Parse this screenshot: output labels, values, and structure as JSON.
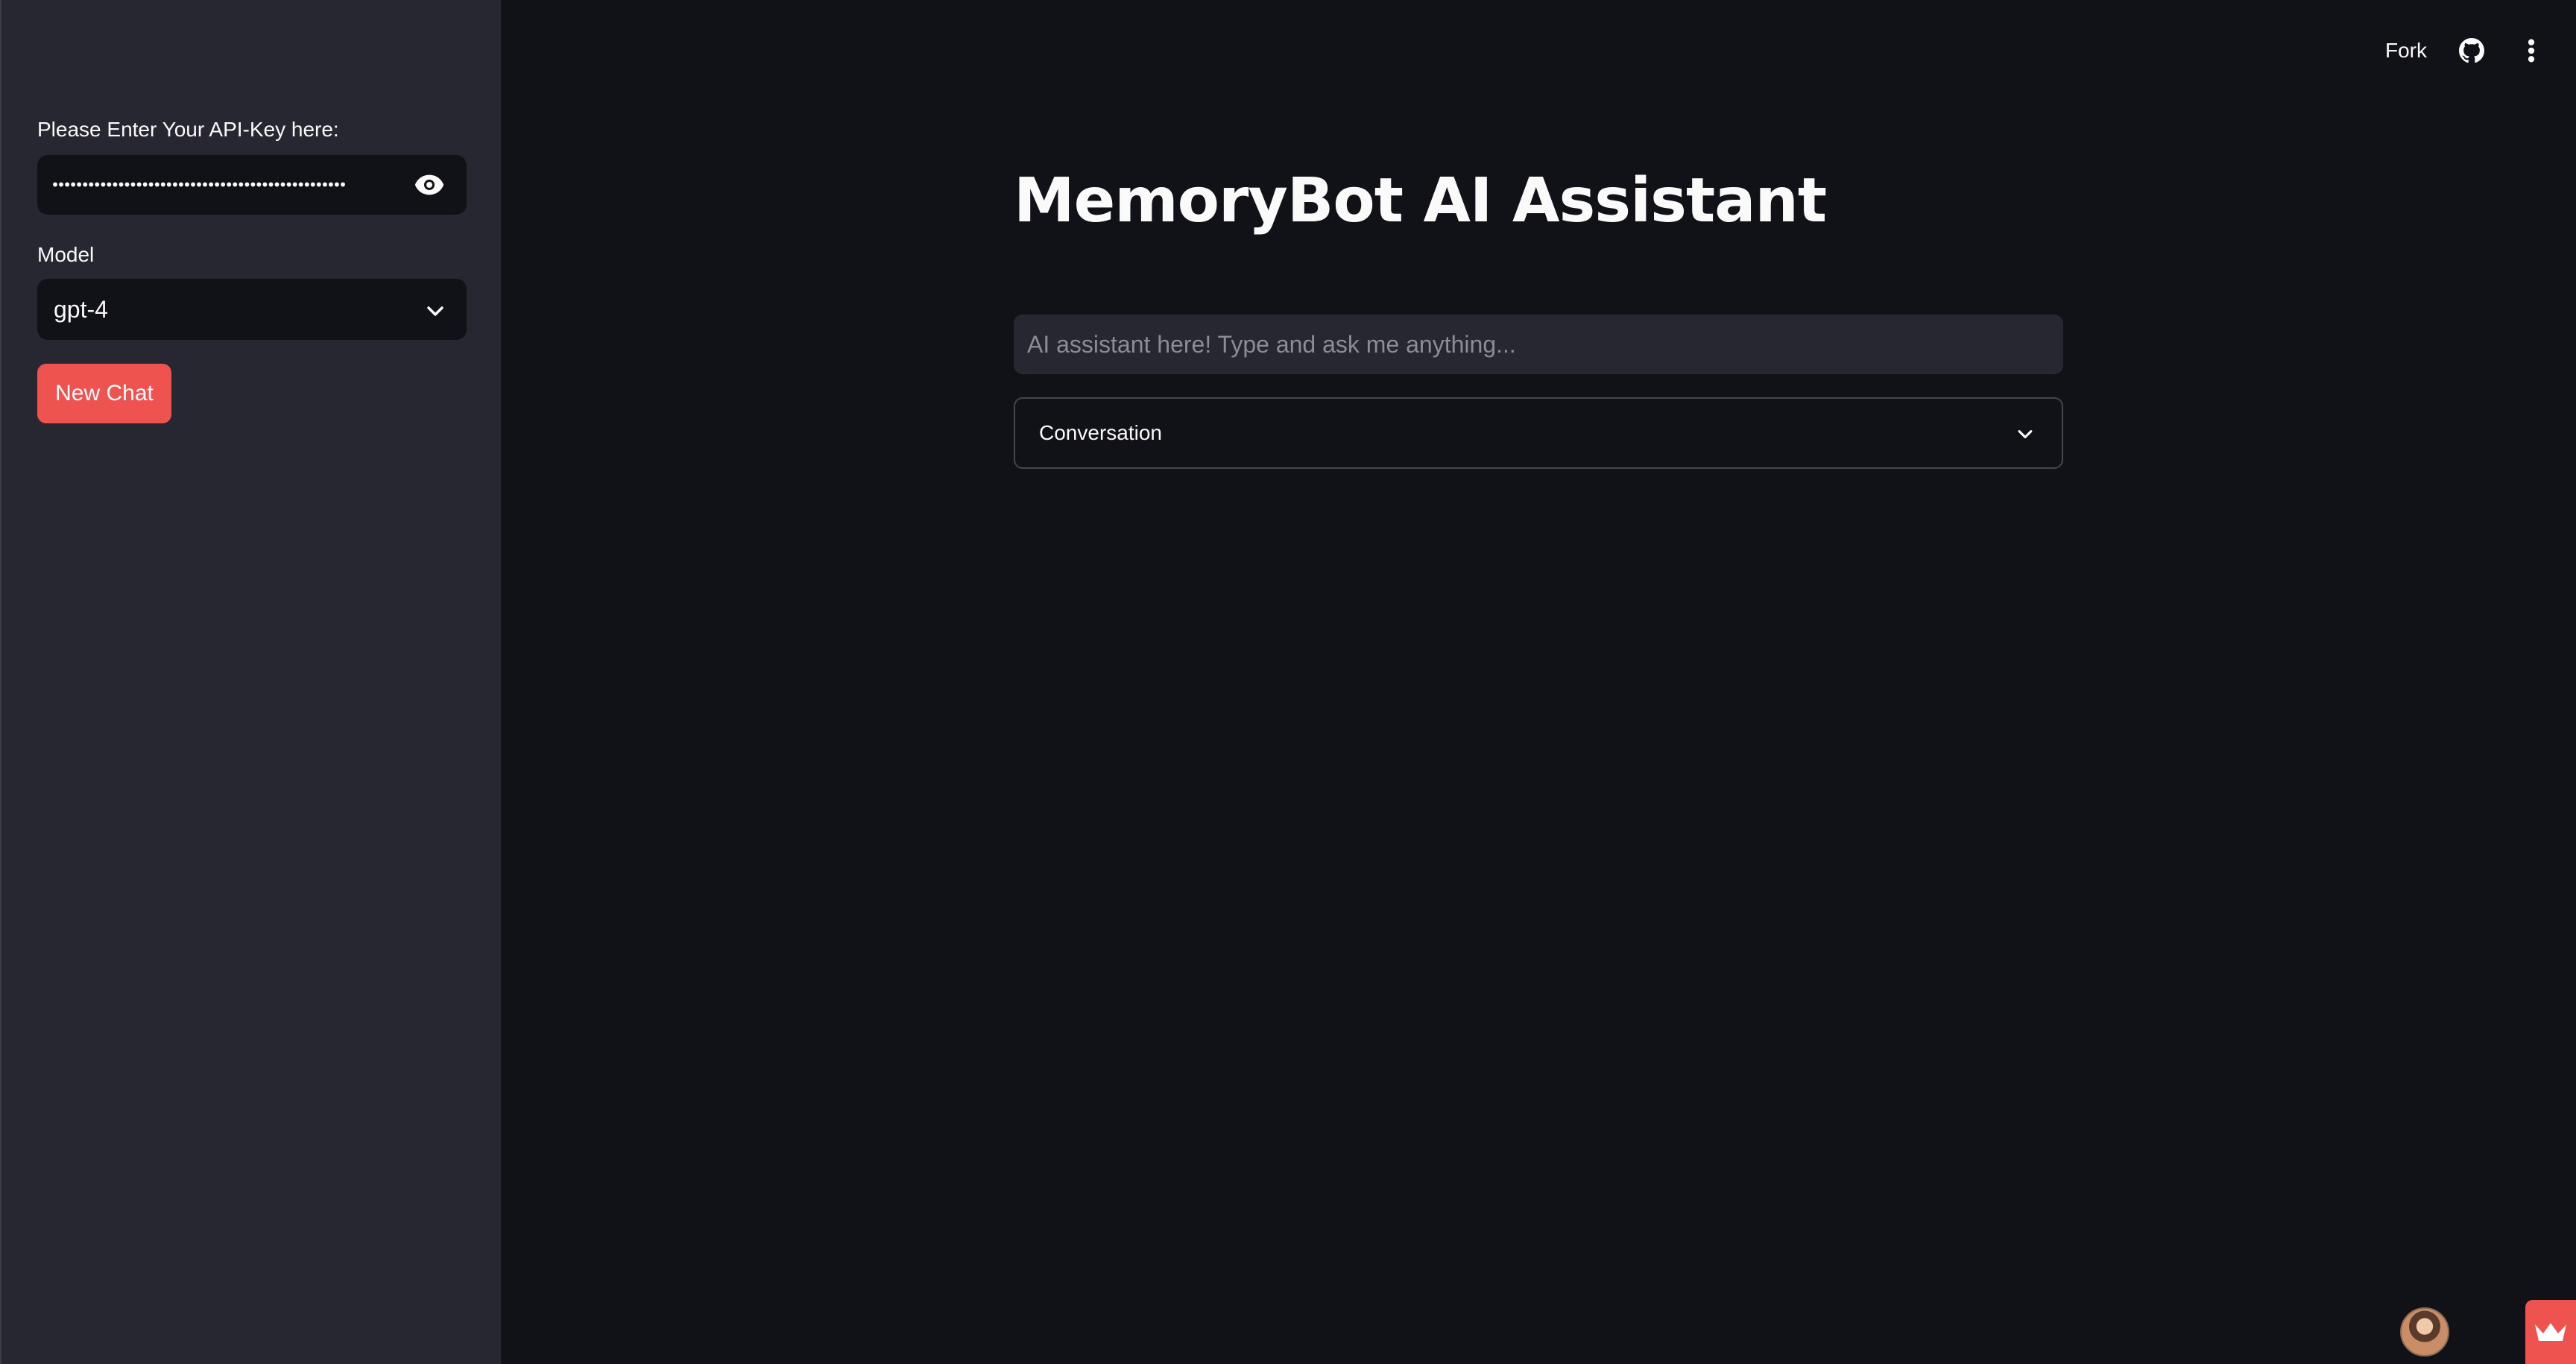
{
  "sidebar": {
    "api_key_label": "Please Enter Your API-Key here:",
    "api_key_value": "•••••••••••••••••••••••••••••••••••••••••••••••••",
    "model_label": "Model",
    "model_selected": "gpt-4",
    "new_chat_label": "New Chat"
  },
  "toolbar": {
    "fork_label": "Fork"
  },
  "main": {
    "title": "MemoryBot AI Assistant",
    "input_placeholder": "AI assistant here! Type and ask me anything...",
    "expander_label": "Conversation"
  },
  "colors": {
    "background": "#111218",
    "sidebar": "#262730",
    "accent": "#ef5350",
    "text": "#fafafa"
  },
  "icons": {
    "password_toggle": "eye-icon",
    "select_arrow": "chevron-down-icon",
    "expander_arrow": "chevron-down-icon",
    "github": "github-icon",
    "menu": "more-vertical-icon",
    "badge": "crown-icon"
  }
}
